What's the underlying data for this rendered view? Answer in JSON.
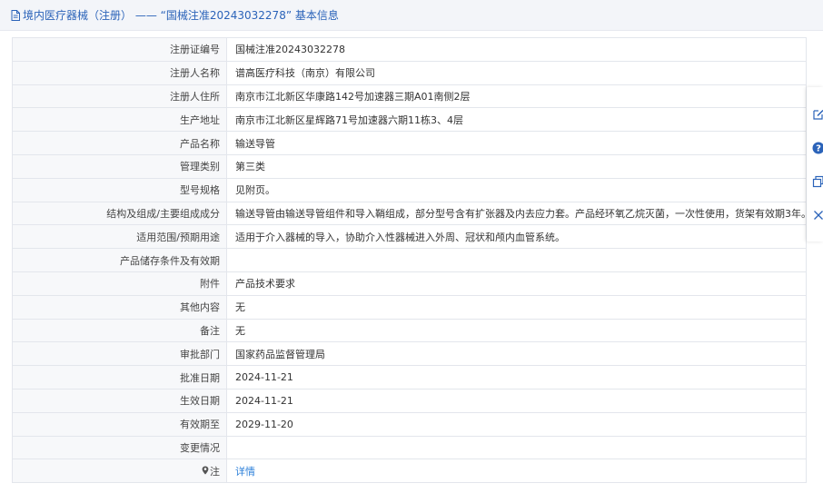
{
  "header": {
    "title": "境内医疗器械（注册） —— “国械注准20243032278” 基本信息"
  },
  "rows": [
    {
      "label": "注册证编号",
      "value": "国械注准20243032278"
    },
    {
      "label": "注册人名称",
      "value": "谱高医疗科技（南京）有限公司"
    },
    {
      "label": "注册人住所",
      "value": "南京市江北新区华康路142号加速器三期A01南侧2层"
    },
    {
      "label": "生产地址",
      "value": "南京市江北新区星辉路71号加速器六期11栋3、4层"
    },
    {
      "label": "产品名称",
      "value": "输送导管"
    },
    {
      "label": "管理类别",
      "value": "第三类"
    },
    {
      "label": "型号规格",
      "value": "见附页。"
    },
    {
      "label": "结构及组成/主要组成成分",
      "value": "输送导管由输送导管组件和导入鞘组成，部分型号含有扩张器及内去应力套。产品经环氧乙烷灭菌，一次性使用，货架有效期3年。"
    },
    {
      "label": "适用范围/预期用途",
      "value": "适用于介入器械的导入，协助介入性器械进入外周、冠状和颅内血管系统。"
    },
    {
      "label": "产品储存条件及有效期",
      "value": ""
    },
    {
      "label": "附件",
      "value": "产品技术要求"
    },
    {
      "label": "其他内容",
      "value": "无"
    },
    {
      "label": "备注",
      "value": "无"
    },
    {
      "label": "审批部门",
      "value": "国家药品监督管理局"
    },
    {
      "label": "批准日期",
      "value": "2024-11-21"
    },
    {
      "label": "生效日期",
      "value": "2024-11-21"
    },
    {
      "label": "有效期至",
      "value": "2029-11-20"
    },
    {
      "label": "变更情况",
      "value": ""
    }
  ],
  "note_row": {
    "label": "注",
    "link": "详情"
  },
  "icons": {
    "header": "document-icon",
    "note": "pin-icon",
    "side": [
      "edit-icon",
      "help-icon",
      "copy-icon",
      "close-icon"
    ]
  },
  "colors": {
    "accent": "#2b63b9",
    "link": "#2b7fd9",
    "label_bg": "#f7f8fa",
    "border": "#e3e6ec"
  }
}
